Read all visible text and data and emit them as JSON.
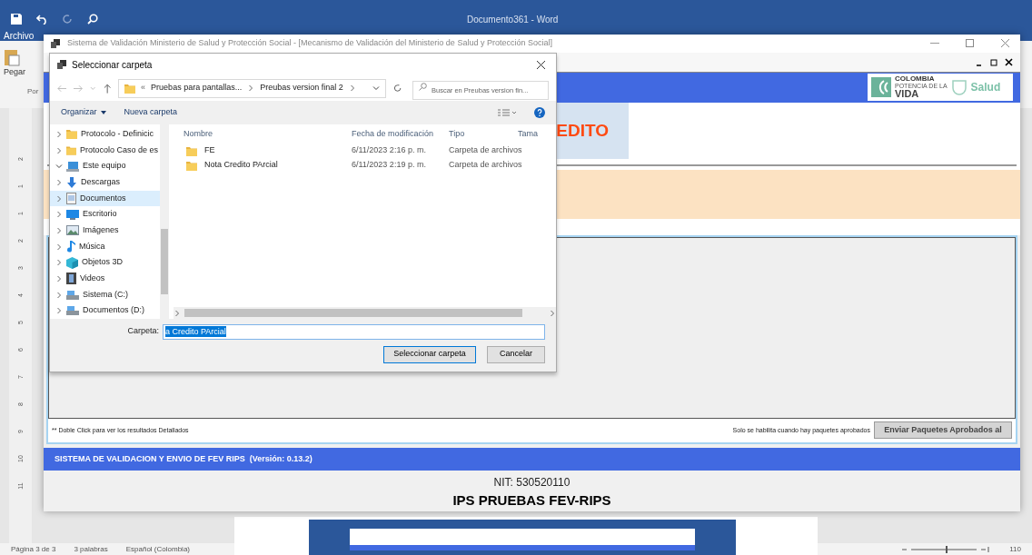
{
  "word": {
    "title": "Documento361 - Word",
    "file_tab": "Archivo",
    "paste_label": "Pegar",
    "group_label": "Por",
    "ruler": [
      "2",
      "1",
      "1",
      "2",
      "3",
      "4",
      "5",
      "6",
      "7",
      "8",
      "9",
      "10",
      "11"
    ],
    "status_bar": {
      "page": "Página 3 de 3",
      "words": "3 palabras",
      "language": "Español (Colombia)",
      "zoom": "110"
    }
  },
  "app": {
    "title": "Sistema de Validación Ministerio de Salud y Protección Social - [Mecanismo de Validación del Ministerio de Salud y Protección Social]",
    "logo": {
      "line1": "COLOMBIA",
      "line2": "POTENCIA DE LA",
      "line3": "VIDA",
      "brand": "Salud"
    },
    "heading": "EDITO",
    "note": "** Doble Click para ver los resultados Detallados",
    "send_hint": "Solo se habilita cuando hay paquetes aprobados",
    "send_button": {
      "label": "Enviar Paquetes Aprobados al",
      "disabled": true
    },
    "footer": "SISTEMA DE VALIDACION Y ENVIO DE FEV RIPS  (Versión: 0.13.2)",
    "nit": "NIT: 530520110",
    "company": "IPS PRUEBAS FEV-RIPS"
  },
  "dialog": {
    "title": "Seleccionar carpeta",
    "breadcrumb": {
      "overflow": "«",
      "parts": [
        "Pruebas para pantallas...",
        "Preubas version final 2"
      ]
    },
    "search": {
      "placeholder": "Buscar en Preubas version fin..."
    },
    "toolbar": [
      "Organizar",
      "Nueva carpeta"
    ],
    "tree": [
      {
        "label": "Protocolo - Definicic",
        "kind": "folder",
        "selected": false,
        "expanded": false
      },
      {
        "label": "Protocolo Caso de es",
        "kind": "folder",
        "selected": false,
        "expanded": false
      },
      {
        "label": "Este equipo",
        "kind": "computer",
        "selected": false,
        "expanded": true,
        "children": [
          {
            "label": "Descargas",
            "kind": "download",
            "selected": false,
            "expanded": false
          },
          {
            "label": "Documentos",
            "kind": "document",
            "selected": true,
            "expanded": false
          },
          {
            "label": "Escritorio",
            "kind": "desktop",
            "selected": false,
            "expanded": false
          },
          {
            "label": "Imágenes",
            "kind": "picture",
            "selected": false,
            "expanded": false
          },
          {
            "label": "Música",
            "kind": "music",
            "selected": false,
            "expanded": false
          },
          {
            "label": "Objetos 3D",
            "kind": "cube",
            "selected": false,
            "expanded": false
          },
          {
            "label": "Videos",
            "kind": "film",
            "selected": false,
            "expanded": false
          },
          {
            "label": "Sistema (C:)",
            "kind": "drive",
            "selected": false,
            "expanded": false
          },
          {
            "label": "Documentos (D:)",
            "kind": "drive",
            "selected": false,
            "expanded": false
          }
        ]
      }
    ],
    "columns": [
      "Nombre",
      "Fecha de modificación",
      "Tipo",
      "Tama"
    ],
    "files": [
      {
        "name": "FE",
        "modified": "6/11/2023 2:16 p. m.",
        "type": "Carpeta de archivos"
      },
      {
        "name": "Nota Credito PArcial",
        "modified": "6/11/2023 2:19 p. m.",
        "type": "Carpeta de archivos"
      }
    ],
    "folder_label": "Carpeta:",
    "folder_value": "a Credito PArcial",
    "buttons": [
      "Seleccionar carpeta",
      "Cancelar"
    ]
  }
}
